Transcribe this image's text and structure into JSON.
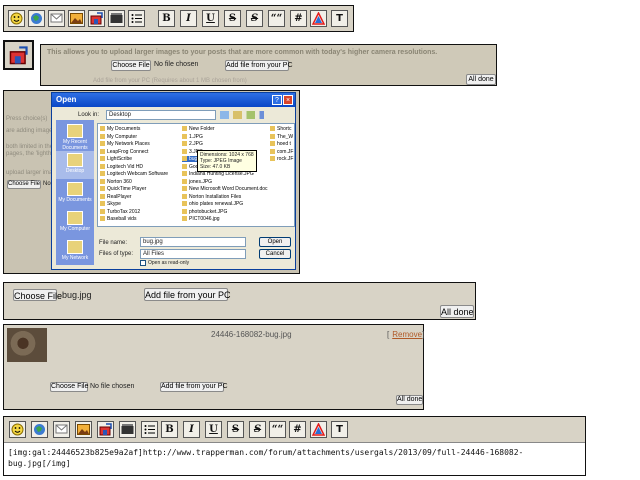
{
  "toolbar": {
    "format_buttons": [
      "B",
      "I",
      "U",
      "S",
      "S",
      "““",
      "#",
      "",
      "T"
    ]
  },
  "upload_bar": {
    "description": "This allows you to upload larger images to your posts that are more common with today's higher camera resolutions.",
    "choose_file": "Choose File",
    "no_file": "No file chosen",
    "add_file": "Add file from your PC",
    "all_done": "All done",
    "obscured_text": "Add file from your PC (Requires about 1 MB chosen from)"
  },
  "background_page": {
    "left_snippets": [
      "Press choice(s)",
      "are adding image",
      "both limited in the",
      "pages, the 'lighthouse'",
      "upload larger imag"
    ],
    "choose_file": "Choose File",
    "no_file": "No"
  },
  "open_dialog": {
    "title": "Open",
    "look_in_label": "Look in:",
    "look_in_value": "Desktop",
    "places": [
      "My Recent Documents",
      "Desktop",
      "My Documents",
      "My Computer",
      "My Network"
    ],
    "files_col1": [
      "My Documents",
      "My Computer",
      "My Network Places",
      "LeapFrog Connect",
      "LightScribe",
      "Logitech Vid HD",
      "Logitech Webcam Software",
      "Norton 360",
      "QuickTime Player",
      "RealPlayer",
      "Skype",
      "TurboTax 2012",
      "Baseball vids"
    ],
    "files_col2": [
      "New Folder",
      "1.JPG",
      "2.JPG",
      "3.JPG",
      "bug.jpg",
      "Google Chro",
      "Indiana Hunting License.JPG",
      "jones.JPG",
      "New Microsoft Word Document.doc",
      "Norton Installation Files",
      "ohio plates renewal.JPG",
      "photobucket.JPG",
      "PICT0046.jpg"
    ],
    "files_col3": [
      "Shortc",
      "The_W",
      "hoed t",
      "com.JF",
      "rock.JF"
    ],
    "tooltip": [
      "Dimensions: 1024 x 768",
      "Type: JPEG Image",
      "Size: 47.0 KB"
    ],
    "file_name_label": "File name:",
    "file_name_value": "bug.jpg",
    "file_type_label": "Files of type:",
    "file_type_value": "All Files",
    "read_only": "Open as read-only",
    "open_btn": "Open",
    "cancel_btn": "Cancel"
  },
  "chosen_bar": {
    "choose_file": "Choose File",
    "file_value": "bug.jpg",
    "add_file": "Add file from your PC",
    "all_done": "All done"
  },
  "uploaded": {
    "filename": "24446-168082-bug.jpg",
    "remove": "Remove",
    "bracket_open": "[",
    "bracket_close": "]",
    "choose_file": "Choose File",
    "no_file": "No file chosen",
    "add_file": "Add file from your PC",
    "all_done": "All done"
  },
  "editor": {
    "content_line1": "[img:gal:24446523b825e9a2af]http://www.trapperman.com/forum/attachments/usergals/2013/09/full-24446-168082-",
    "content_line2": "bug.jpg[/img]"
  }
}
